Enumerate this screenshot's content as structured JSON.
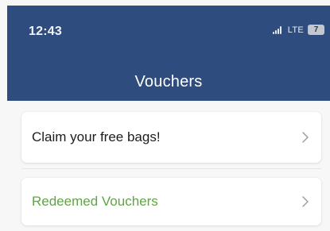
{
  "status_bar": {
    "time": "12:43",
    "network": "LTE",
    "battery_level": "7"
  },
  "header": {
    "title": "Vouchers",
    "background_color": "#2e4d7e"
  },
  "menu": {
    "items": [
      {
        "label": "Claim your free bags!",
        "color": "#1d1d1d",
        "icon": "chevron-right-icon"
      },
      {
        "label": "Redeemed Vouchers",
        "color": "#5ea545",
        "icon": "chevron-right-icon"
      }
    ]
  }
}
